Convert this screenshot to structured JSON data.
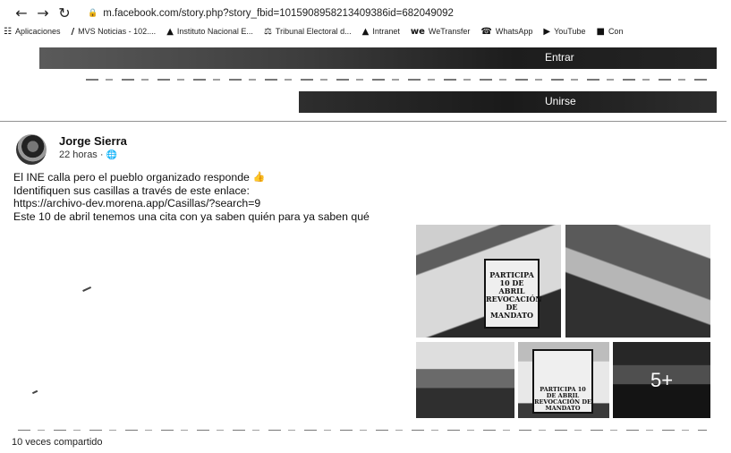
{
  "browser": {
    "url": "m.facebook.com/story.php?story_fbid=1015908958213409386id=682049092",
    "bookmarks": [
      {
        "icon": "apps-icon",
        "glyph": "☷",
        "label": "Aplicaciones"
      },
      {
        "icon": "bookmark-icon",
        "glyph": "/",
        "label": "MVS Noticias - 102...."
      },
      {
        "icon": "bookmark-icon",
        "glyph": "▲",
        "label": "Instituto Nacional E..."
      },
      {
        "icon": "bookmark-icon",
        "glyph": "⚖",
        "label": "Tribunal Electoral d..."
      },
      {
        "icon": "bookmark-icon",
        "glyph": "▲",
        "label": "Intranet"
      },
      {
        "icon": "bookmark-icon",
        "glyph": "we",
        "label": "WeTransfer"
      },
      {
        "icon": "whatsapp-icon",
        "glyph": "☎",
        "label": "WhatsApp"
      },
      {
        "icon": "youtube-icon",
        "glyph": "▶",
        "label": "YouTube"
      },
      {
        "icon": "bookmark-icon",
        "glyph": "■",
        "label": "Con"
      }
    ]
  },
  "buttons": {
    "entrar": "Entrar",
    "unirse": "Unirse"
  },
  "post": {
    "author": "Jorge Sierra",
    "time": "22 horas",
    "lines": [
      "El INE calla pero el pueblo organizado responde",
      "Identifiquen sus casillas a través de este enlace:",
      "https://archivo-dev.morena.app/Casillas/?search=9",
      "Este 10 de abril tenemos una cita con ya saben quién para ya saben qué"
    ],
    "photo_sign_large": "PARTICIPA 10 DE ABRIL REVOCACIÓN DE MANDATO",
    "photo_sign_small": "PARTICIPA 10 DE ABRIL REVOCACIÓN DE MANDATO",
    "more_photos": "5+",
    "shares": "10 veces compartido"
  }
}
